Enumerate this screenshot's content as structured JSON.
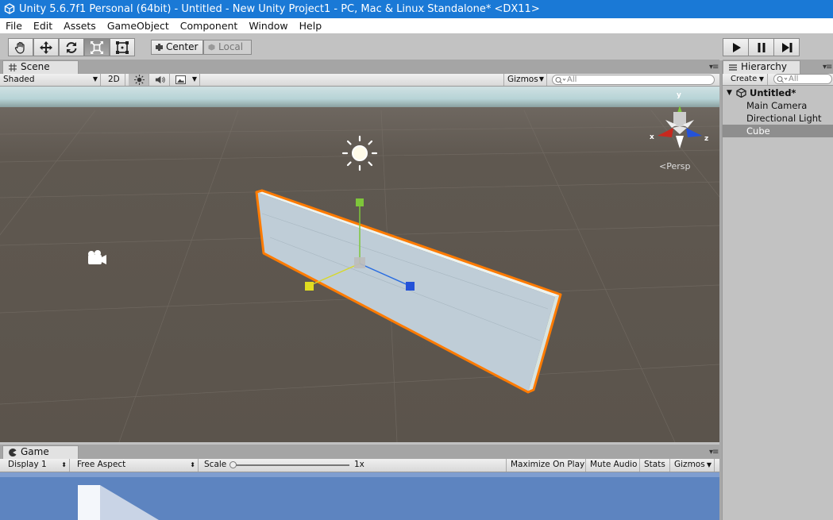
{
  "window": {
    "title": "Unity 5.6.7f1 Personal (64bit) - Untitled - New Unity Project1 - PC, Mac & Linux Standalone* <DX11>"
  },
  "menu": [
    "File",
    "Edit",
    "Assets",
    "GameObject",
    "Component",
    "Window",
    "Help"
  ],
  "toolbar": {
    "tools": [
      "hand-tool",
      "move-tool",
      "rotate-tool",
      "scale-tool",
      "rect-tool"
    ],
    "active_tool": "scale-tool",
    "pivot_mode": "Center",
    "pivot_rotation": "Local",
    "play_controls": [
      "play",
      "pause",
      "step"
    ]
  },
  "scene": {
    "tab_label": "Scene",
    "shading_mode": "Shaded",
    "mode_2d": "2D",
    "gizmos_label": "Gizmos",
    "search_placeholder": "All",
    "projection_label": "Persp",
    "axis_labels": {
      "x": "x",
      "y": "y",
      "z": "z"
    }
  },
  "hierarchy": {
    "tab_label": "Hierarchy",
    "create_label": "Create",
    "search_placeholder": "All",
    "scene_name": "Untitled*",
    "items": [
      {
        "label": "Main Camera",
        "selected": false
      },
      {
        "label": "Directional Light",
        "selected": false
      },
      {
        "label": "Cube",
        "selected": true
      }
    ]
  },
  "game": {
    "tab_label": "Game",
    "display": "Display 1",
    "aspect": "Free Aspect",
    "scale_label": "Scale",
    "scale_value": "1x",
    "maximize_label": "Maximize On Play",
    "mute_label": "Mute Audio",
    "stats_label": "Stats",
    "gizmos_label": "Gizmos"
  },
  "colors": {
    "titlebar": "#1a79d6",
    "selection_outline": "#ff7b00",
    "ground": "#5b544c",
    "sky": "#b7d3d6",
    "game_sky": "#5d84c0"
  }
}
